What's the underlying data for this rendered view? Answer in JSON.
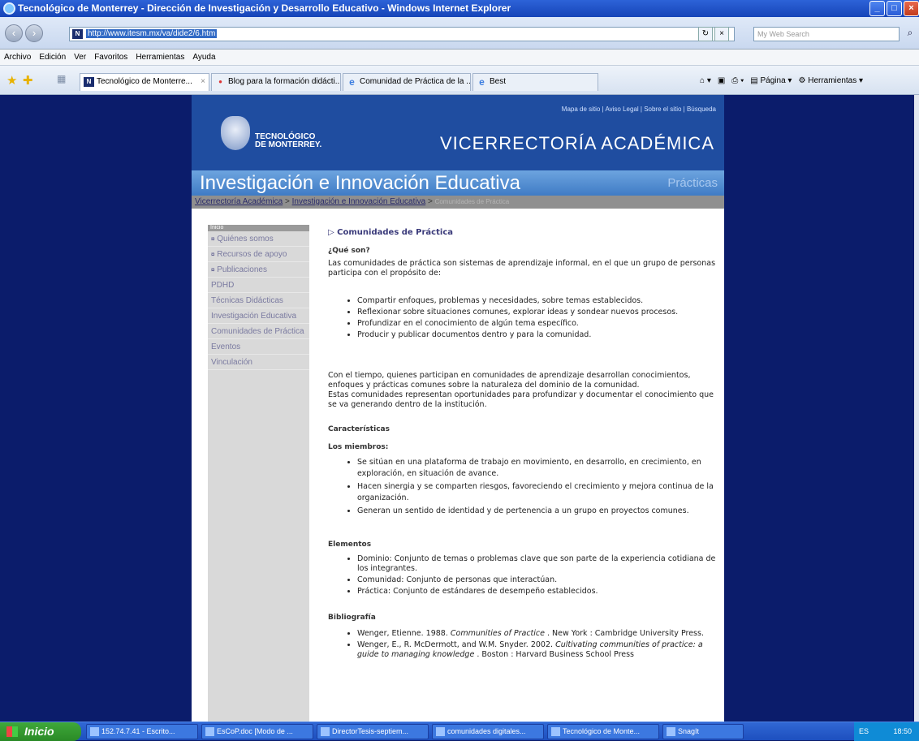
{
  "window": {
    "title": "Tecnológico de Monterrey - Dirección de Investigación y Desarrollo Educativo - Windows Internet Explorer",
    "controls": {
      "min": "_",
      "max": "□",
      "close": "×"
    }
  },
  "navbar": {
    "back_icon": "‹",
    "forward_icon": "›",
    "favicon": "N",
    "url": "http://www.itesm.mx/va/dide2/6.htm",
    "refresh_icon": "↻",
    "stop_icon": "×",
    "search_placeholder": "My Web Search",
    "search_icon": "⌕"
  },
  "menu": [
    "Archivo",
    "Edición",
    "Ver",
    "Favoritos",
    "Herramientas",
    "Ayuda"
  ],
  "tabs": [
    {
      "label": "Tecnológico de Monterre...",
      "icon": "N",
      "icon_color": "#1a2d6e",
      "active": true
    },
    {
      "label": "Blog para la formación didácti...",
      "icon": "●",
      "icon_color": "#d33",
      "active": false
    },
    {
      "label": "Comunidad de Práctica de la ...",
      "icon": "e",
      "icon_color": "#3b7de0",
      "active": false
    },
    {
      "label": "Best",
      "icon": "e",
      "icon_color": "#3b7de0",
      "active": false
    }
  ],
  "toolbar": {
    "pagina": "Página",
    "herramientas": "Herramientas"
  },
  "site": {
    "toplinks": "Mapa de sitio | Aviso Legal | Sobre el sitio | Búsqueda",
    "logo_line1": "TECNOLÓGICO",
    "logo_line2": "DE MONTERREY.",
    "vicerrectoria": "VICERRECTORÍA ACADÉMICA",
    "banner_title": "Investigación e Innovación Educativa",
    "banner_section": "Prácticas",
    "breadcrumb": {
      "link1": "Vicerrectoría Académica",
      "sep": ">",
      "link2": "Investigación e Innovación Educativa",
      "current": "Comunidades de Práctica"
    },
    "sidebar": {
      "header": "Inicio",
      "items": [
        {
          "label": "Quiénes somos",
          "bullet": "¤"
        },
        {
          "label": "Recursos de apoyo",
          "bullet": "¤"
        },
        {
          "label": "Publicaciones",
          "bullet": "¤"
        },
        {
          "label": "PDHD",
          "bullet": ""
        },
        {
          "label": "Técnicas Didácticas",
          "bullet": ""
        },
        {
          "label": "Investigación Educativa",
          "bullet": ""
        },
        {
          "label": "Comunidades de Práctica",
          "bullet": ""
        },
        {
          "label": "Eventos",
          "bullet": ""
        },
        {
          "label": "Vinculación",
          "bullet": ""
        }
      ]
    },
    "content": {
      "title": "Comunidades de Práctica",
      "que_son_heading": "¿Qué son?",
      "intro": "Las comunidades de práctica son sistemas de aprendizaje informal, en el que un grupo de personas participa con el propósito de:",
      "purposes": [
        "Compartir enfoques, problemas y necesidades, sobre temas establecidos.",
        "Reflexionar sobre situaciones comunes, explorar ideas y sondear nuevos procesos.",
        "Profundizar en el conocimiento de algún tema específico.",
        "Producir y publicar documentos dentro y para la comunidad."
      ],
      "para1": "Con el tiempo, quienes participan en comunidades de aprendizaje desarrollan conocimientos, enfoques y prácticas comunes sobre la naturaleza del dominio de la comunidad.",
      "para2": "Estas comunidades representan oportunidades para profundizar y documentar el conocimiento que se va generando dentro de la institución.",
      "caracteristicas_heading": "Características",
      "miembros_heading": "Los miembros:",
      "miembros": [
        "Se sitúan en una plataforma de trabajo en movimiento, en desarrollo, en crecimiento, en exploración, en situación de avance.",
        "Hacen sinergia y se comparten riesgos, favoreciendo el crecimiento y mejora continua de la organización.",
        "Generan un sentido de identidad y de pertenencia a un grupo en proyectos comunes."
      ],
      "elementos_heading": "Elementos",
      "elementos": [
        "Dominio: Conjunto de temas o problemas clave que son parte de la experiencia cotidiana de los integrantes.",
        "Comunidad: Conjunto de personas que interactúan.",
        "Práctica: Conjunto de estándares de desempeño establecidos."
      ],
      "bibliografia_heading": "Bibliografía",
      "bibliografia": [
        {
          "pre": "Wenger, Etienne. 1988. ",
          "italic": "Communities of Practice",
          "post": " . New York : Cambridge University Press."
        },
        {
          "pre": "Wenger, E., R. McDermott, and W.M. Snyder. 2002. ",
          "italic": "Cultivating communities of practice: a guide to managing knowledge",
          "post": " . Boston : Harvard Business School Press"
        }
      ]
    }
  },
  "taskbar": {
    "start": "Inicio",
    "items": [
      "152.74.7.41 - Escrito...",
      "EsCoP.doc [Modo de ...",
      "DirectorTesis-septiem...",
      "comunidades digitales...",
      "Tecnológico de Monte...",
      "SnagIt"
    ],
    "lang": "ES",
    "clock": "18:50"
  },
  "colors": {
    "page_background": "#0b1c6b",
    "header_blue": "#1f4da0",
    "banner_blue": "#4f8ad0",
    "sidebar_gray": "#d9d9d9"
  }
}
